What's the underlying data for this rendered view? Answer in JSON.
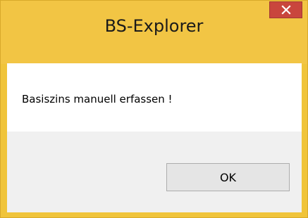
{
  "window": {
    "title": "BS-Explorer"
  },
  "dialog": {
    "message": "Basiszins manuell erfassen !",
    "ok_label": "OK"
  },
  "icons": {
    "close": "close-icon"
  },
  "colors": {
    "titlebar": "#f2c544",
    "close_button": "#c9463d",
    "content_background": "#ffffff",
    "button_area_background": "#f0f0f0"
  }
}
